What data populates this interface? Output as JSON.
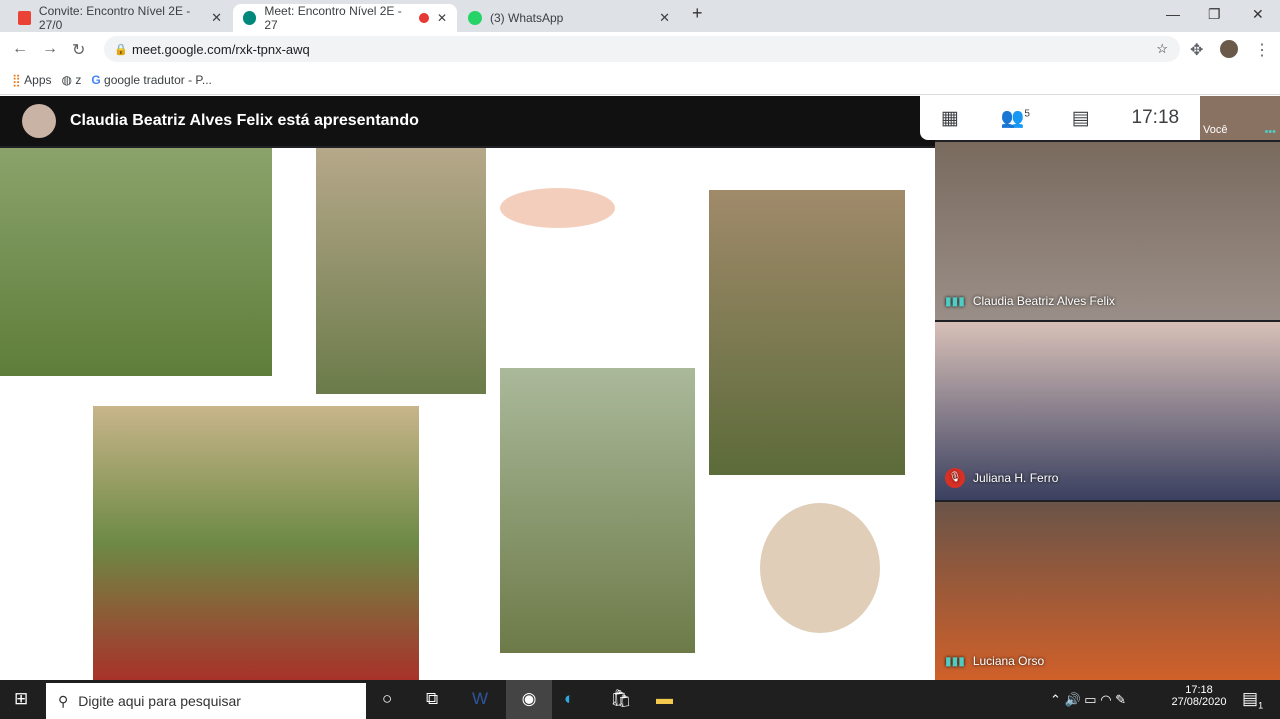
{
  "browser": {
    "tabs": [
      {
        "title": "Convite: Encontro Nível 2E - 27/0",
        "icon": "gmail-icon"
      },
      {
        "title": "Meet: Encontro Nível 2E - 27",
        "icon": "meet-icon",
        "active": true,
        "recording": true
      },
      {
        "title": "(3) WhatsApp",
        "icon": "whatsapp-icon"
      }
    ],
    "url": "meet.google.com/rxk-tpnx-awq",
    "bookmarks": [
      "Apps",
      "z",
      "google tradutor - P..."
    ]
  },
  "meet": {
    "presenting": "Claudia Beatriz Alves Felix está apresentando",
    "participants_count": "5",
    "time": "17:18",
    "self_label": "Você",
    "tiles": [
      {
        "name": "Claudia Beatriz Alves Felix",
        "muted": false
      },
      {
        "name": "Juliana H. Ferro",
        "muted": true
      },
      {
        "name": "Luciana Orso",
        "muted": false
      }
    ]
  },
  "taskbar": {
    "search_placeholder": "Digite aqui para pesquisar",
    "time": "17:18",
    "date": "27/08/2020",
    "notifications": "1"
  }
}
